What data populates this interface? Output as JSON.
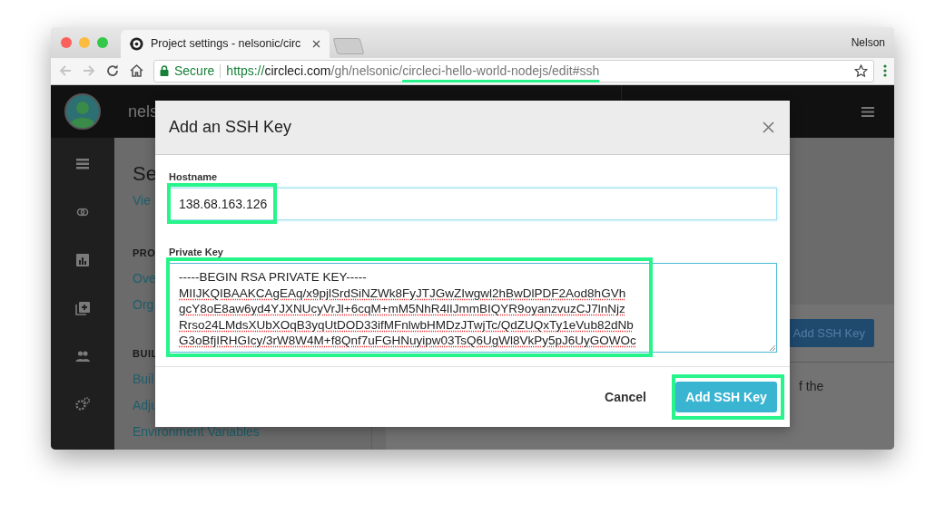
{
  "window": {
    "user": "Nelson"
  },
  "tab": {
    "title": "Project settings - nelsonic/circ"
  },
  "address_bar": {
    "security": "Secure",
    "scheme": "https://",
    "host": "circleci.com",
    "path": "/gh/nelsonic/",
    "path_highlighted": "circleci-hello-world-nodejs/edit#ssh"
  },
  "app": {
    "username": "nels",
    "page_title": "Se",
    "page_link": "Vie",
    "nav": [
      {
        "kind": "header",
        "label": "PRO"
      },
      {
        "kind": "link",
        "label": "Ove"
      },
      {
        "kind": "link",
        "label": "Org"
      },
      {
        "kind": "header",
        "label": "BUIL"
      },
      {
        "kind": "link",
        "label": "Buil"
      },
      {
        "kind": "link",
        "label": "Adju"
      },
      {
        "kind": "link",
        "label": "Environment Variables"
      }
    ],
    "panel": {
      "button": "Add SSH Key",
      "text": "f the"
    }
  },
  "dialog": {
    "title": "Add an SSH Key",
    "hostname": {
      "label": "Hostname",
      "value": "138.68.163.126"
    },
    "private_key": {
      "label": "Private Key",
      "lines": [
        "-----BEGIN RSA PRIVATE KEY-----",
        "MIIJKQIBAAKCAgEAq/x9pjlSrdSiNZWk8FyJTJGwZIwgwl2hBwDlPDF2Aod8hGVh",
        "gcY8oE8aw6yd4YJXNUcyVrJl+6cqM+mM5NhR4lIJmmBIQYR9oyanzvuzCJ7lnNjz",
        "Rrso24LMdsXUbXOqB3yqUtDOD33ifMFnlwbHMDzJTwjTc/QdZUQxTy1eVub82dNb",
        "G3oBfjIRHGIcy/3rW8W4M+f8Qnf7uFGHNuyipw03TsQ6UgWl8VkPy5pJ6UyGOWOc"
      ]
    },
    "buttons": [
      {
        "kind": "secondary",
        "label": "Cancel"
      },
      {
        "kind": "primary",
        "label": "Add SSH Key"
      }
    ]
  }
}
